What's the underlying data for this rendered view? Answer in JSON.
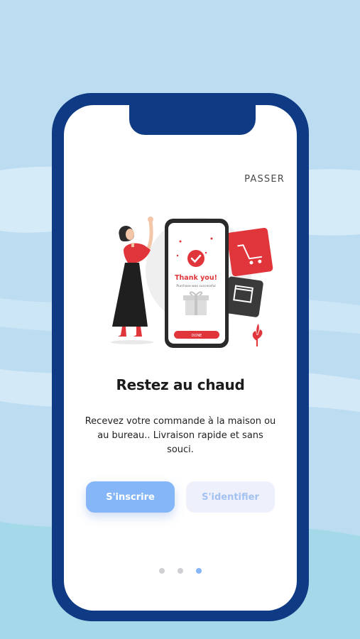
{
  "onboarding": {
    "skip_label": "PASSER",
    "title": "Restez au chaud",
    "description": "Recevez votre commande à la maison ou au bureau.. Livraison rapide et sans souci.",
    "signup_label": "S'inscrire",
    "login_label": "S'identifier",
    "pagination": {
      "total": 3,
      "active_index": 3
    }
  },
  "illustration": {
    "thank_you_text": "Thank you!",
    "purchase_text": "Purchase was successful",
    "done_label": "DONE"
  },
  "colors": {
    "background": "#bcdcf2",
    "phone_frame": "#0f3a84",
    "primary_button": "#85b6f8",
    "secondary_button": "#eef0fb",
    "accent_red": "#e0353b",
    "active_dot": "#86b6f7",
    "inactive_dot": "#cfcfd4"
  }
}
